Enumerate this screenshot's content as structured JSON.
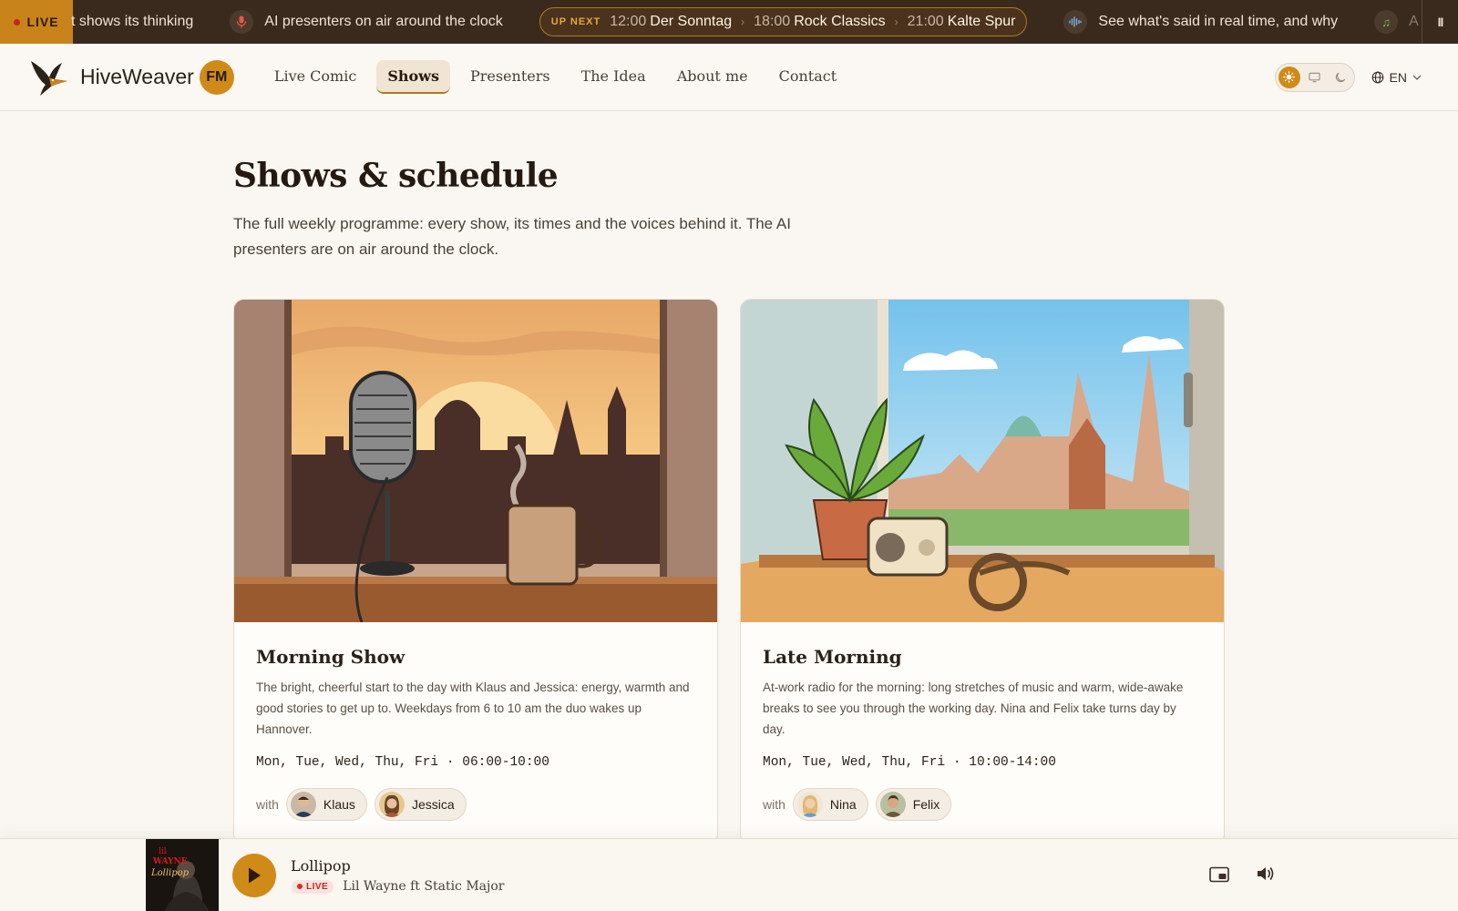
{
  "ticker": {
    "live_label": "LIVE",
    "items": [
      {
        "icon": "brain-icon",
        "text": "t shows its thinking"
      },
      {
        "icon": "microphone-icon",
        "text": "AI presenters on air around the clock"
      },
      {
        "icon": "waveform-icon",
        "text": "See what's said in real time, and why"
      },
      {
        "icon": "music-note-icon",
        "text": "A"
      }
    ],
    "up_next": {
      "label": "UP NEXT",
      "entries": [
        {
          "time": "12:00",
          "title": "Der Sonntag"
        },
        {
          "time": "18:00",
          "title": "Rock Classics"
        },
        {
          "time": "21:00",
          "title": "Kalte Spur"
        }
      ]
    },
    "pause_label": "II"
  },
  "nav": {
    "brand": "HiveWeaver",
    "badge": "FM",
    "links": [
      "Live Comic",
      "Shows",
      "Presenters",
      "The Idea",
      "About me",
      "Contact"
    ],
    "active_link": "Shows",
    "language": "EN"
  },
  "main": {
    "title": "Shows & schedule",
    "intro": "The full weekly programme: every show, its times and the voices behind it. The AI presenters are on air around the clock."
  },
  "shows": [
    {
      "title": "Morning Show",
      "description": "The bright, cheerful start to the day with Klaus and Jessica: energy, warmth and good stories to get up to. Weekdays from 6 to 10 am the duo wakes up Hannover.",
      "schedule": "Mon, Tue, Wed, Thu, Fri · 06:00-10:00",
      "with_label": "with",
      "presenters": [
        "Klaus",
        "Jessica"
      ]
    },
    {
      "title": "Late Morning",
      "description": "At-work radio for the morning: long stretches of music and warm, wide-awake breaks to see you through the working day. Nina and Felix take turns day by day.",
      "schedule": "Mon, Tue, Wed, Thu, Fri · 10:00-14:00",
      "with_label": "with",
      "presenters": [
        "Nina",
        "Felix"
      ]
    }
  ],
  "player": {
    "title": "Lollipop",
    "live_label": "LIVE",
    "artist": "Lil Wayne ft Static Major",
    "cover_text_1": "lil",
    "cover_text_2": "WAYNE",
    "cover_text_3": "Lollipop"
  },
  "colors": {
    "accent": "#d08a18",
    "ticker_bg": "#3a2a1e",
    "page_bg": "#faf7f2",
    "live_red": "#c0281c"
  }
}
